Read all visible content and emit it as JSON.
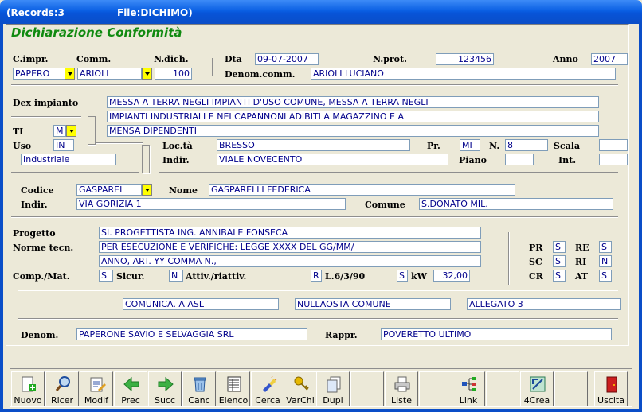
{
  "titlebar": {
    "records": "(Records:3",
    "file": "File:DICHIMO)"
  },
  "header": {
    "title": "Dichiarazione Conformità"
  },
  "row1": {
    "cimpr_label": "C.impr.",
    "comm_label": "Comm.",
    "ndich_label": "N.dich.",
    "dta_label": "Dta",
    "dta_value": "09-07-2007",
    "nprot_label": "N.prot.",
    "nprot_value": "123456",
    "anno_label": "Anno",
    "anno_value": "2007",
    "cimpr_value": "PAPERO",
    "comm_value": "ARIOLI",
    "ndich_value": "100",
    "denomcomm_label": "Denom.comm.",
    "denomcomm_value": "ARIOLI LUCIANO"
  },
  "impianto": {
    "dex_label": "Dex impianto",
    "dex_lines": [
      "MESSA A TERRA NEGLI IMPIANTI D'USO COMUNE, MESSA A TERRA NEGLI",
      "IMPIANTI INDUSTRIALI E NEI CAPANNONI ADIBITI A MAGAZZINO E A",
      "MENSA DIPENDENTI"
    ],
    "ti_label": "TI",
    "ti_value": "M",
    "uso_label": "Uso",
    "uso_value": "IN",
    "uso_desc": "Industriale",
    "locta_label": "Loc.tà",
    "locta_value": "BRESSO",
    "pr_label": "Pr.",
    "pr_value": "MI",
    "n_label": "N.",
    "n_value": "8",
    "scala_label": "Scala",
    "scala_value": "",
    "indir_label": "Indir.",
    "indir_value": "VIALE NOVECENTO",
    "piano_label": "Piano",
    "piano_value": "",
    "int_label": "Int.",
    "int_value": ""
  },
  "cliente": {
    "codice_label": "Codice",
    "codice_value": "GASPAREL",
    "nome_label": "Nome",
    "nome_value": "GASPARELLI FEDERICA",
    "indir_label": "Indir.",
    "indir_value": "VIA GORIZIA 1",
    "comune_label": "Comune",
    "comune_value": "S.DONATO MIL."
  },
  "progetto": {
    "progetto_label": "Progetto",
    "progetto_value": "SI. PROGETTISTA ING. ANNIBALE FONSECA",
    "norme_label": "Norme tecn.",
    "norme_lines": [
      "PER ESECUZIONE E VERIFICHE: LEGGE XXXX DEL GG/MM/",
      "ANNO, ART. YY COMMA N.,"
    ],
    "compmat_label": "Comp./Mat.",
    "compmat_value": "S",
    "sicur_label": "Sicur.",
    "sicur_value": "N",
    "attiv_label": "Attiv./riattiv.",
    "attiv_value": "R",
    "legge_label": "L.6/3/90",
    "legge_value": "S",
    "kw_label": "kW",
    "kw_value": "32,00"
  },
  "flags": {
    "pr_label": "PR",
    "pr_value": "S",
    "re_label": "RE",
    "re_value": "S",
    "sc_label": "SC",
    "sc_value": "S",
    "ri_label": "RI",
    "ri_value": "N",
    "cr_label": "CR",
    "cr_value": "S",
    "at_label": "AT",
    "at_value": "S"
  },
  "allegati": [
    "COMUNICA. A ASL",
    "NULLAOSTA COMUNE",
    "ALLEGATO 3"
  ],
  "ditta": {
    "denom_label": "Denom.",
    "denom_value": "PAPERONE SAVIO E SELVAGGIA SRL",
    "rappr_label": "Rappr.",
    "rappr_value": "POVERETTO ULTIMO"
  },
  "toolbar": {
    "nuovo": "Nuovo",
    "ricer": "Ricer",
    "modif": "Modif",
    "prec": "Prec",
    "succ": "Succ",
    "canc": "Canc",
    "elenco": "Elenco",
    "cerca": "Cerca",
    "varchi": "VarChi",
    "dupl": "Dupl",
    "liste": "Liste",
    "link": "Link",
    "crea": "4Crea",
    "uscita": "Uscita"
  },
  "colors": {
    "accent_title": "#108A10",
    "field_text": "#00008B",
    "dropdown": "#FFFF00",
    "titlebar": "#0A5FE3"
  }
}
